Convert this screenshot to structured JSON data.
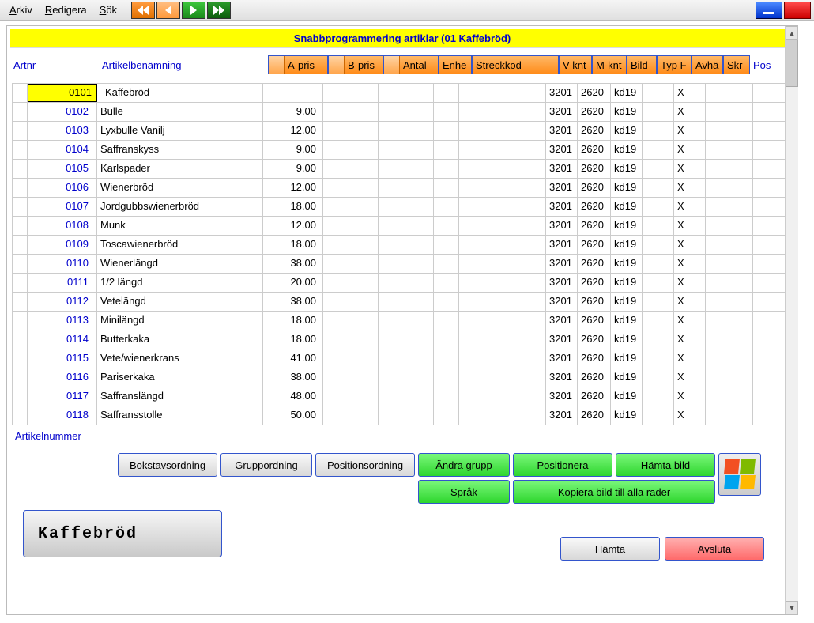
{
  "menu": {
    "arkiv": "Arkiv",
    "redigera": "Redigera",
    "sok": "Sök"
  },
  "title": "Snabbprogrammering artiklar (01 Kaffebröd)",
  "headers": {
    "artnr": "Artnr",
    "artben": "Artikelbenämning",
    "apris": "A-pris",
    "bpris": "B-pris",
    "antal": "Antal",
    "enh": "Enhe",
    "streck": "Streckkod",
    "vknt": "V-knt",
    "mknt": "M-knt",
    "bild": "Bild",
    "typf": "Typ F",
    "avha": "Avhä",
    "skr": "Skr",
    "pos": "Pos"
  },
  "rows": [
    {
      "artnr": "0101",
      "name": "Kaffebröd",
      "apris": "",
      "vknt": "3201",
      "mknt": "2620",
      "bild": "kd19",
      "avha": "X"
    },
    {
      "artnr": "0102",
      "name": "Bulle",
      "apris": "9.00",
      "vknt": "3201",
      "mknt": "2620",
      "bild": "kd19",
      "avha": "X"
    },
    {
      "artnr": "0103",
      "name": "Lyxbulle Vanilj",
      "apris": "12.00",
      "vknt": "3201",
      "mknt": "2620",
      "bild": "kd19",
      "avha": "X"
    },
    {
      "artnr": "0104",
      "name": "Saffranskyss",
      "apris": "9.00",
      "vknt": "3201",
      "mknt": "2620",
      "bild": "kd19",
      "avha": "X"
    },
    {
      "artnr": "0105",
      "name": "Karlspader",
      "apris": "9.00",
      "vknt": "3201",
      "mknt": "2620",
      "bild": "kd19",
      "avha": "X"
    },
    {
      "artnr": "0106",
      "name": "Wienerbröd",
      "apris": "12.00",
      "vknt": "3201",
      "mknt": "2620",
      "bild": "kd19",
      "avha": "X"
    },
    {
      "artnr": "0107",
      "name": "Jordgubbswienerbröd",
      "apris": "18.00",
      "vknt": "3201",
      "mknt": "2620",
      "bild": "kd19",
      "avha": "X"
    },
    {
      "artnr": "0108",
      "name": "Munk",
      "apris": "12.00",
      "vknt": "3201",
      "mknt": "2620",
      "bild": "kd19",
      "avha": "X"
    },
    {
      "artnr": "0109",
      "name": "Toscawienerbröd",
      "apris": "18.00",
      "vknt": "3201",
      "mknt": "2620",
      "bild": "kd19",
      "avha": "X"
    },
    {
      "artnr": "0110",
      "name": "Wienerlängd",
      "apris": "38.00",
      "vknt": "3201",
      "mknt": "2620",
      "bild": "kd19",
      "avha": "X"
    },
    {
      "artnr": "0111",
      "name": "1/2 längd",
      "apris": "20.00",
      "vknt": "3201",
      "mknt": "2620",
      "bild": "kd19",
      "avha": "X"
    },
    {
      "artnr": "0112",
      "name": "Vetelängd",
      "apris": "38.00",
      "vknt": "3201",
      "mknt": "2620",
      "bild": "kd19",
      "avha": "X"
    },
    {
      "artnr": "0113",
      "name": "Minilängd",
      "apris": "18.00",
      "vknt": "3201",
      "mknt": "2620",
      "bild": "kd19",
      "avha": "X"
    },
    {
      "artnr": "0114",
      "name": "Butterkaka",
      "apris": "18.00",
      "vknt": "3201",
      "mknt": "2620",
      "bild": "kd19",
      "avha": "X"
    },
    {
      "artnr": "0115",
      "name": "Vete/wienerkrans",
      "apris": "41.00",
      "vknt": "3201",
      "mknt": "2620",
      "bild": "kd19",
      "avha": "X"
    },
    {
      "artnr": "0116",
      "name": "Pariserkaka",
      "apris": "38.00",
      "vknt": "3201",
      "mknt": "2620",
      "bild": "kd19",
      "avha": "X"
    },
    {
      "artnr": "0117",
      "name": "Saffranslängd",
      "apris": "48.00",
      "vknt": "3201",
      "mknt": "2620",
      "bild": "kd19",
      "avha": "X"
    },
    {
      "artnr": "0118",
      "name": "Saffransstolle",
      "apris": "50.00",
      "vknt": "3201",
      "mknt": "2620",
      "bild": "kd19",
      "avha": "X"
    }
  ],
  "footer_label": "Artikelnummer",
  "buttons": {
    "bokstav": "Bokstavsordning",
    "grupp": "Gruppordning",
    "position": "Positionsordning",
    "andra_grupp": "Ändra grupp",
    "positionera": "Positionera",
    "hamta_bild": "Hämta bild",
    "sprak": "Språk",
    "kopiera": "Kopiera bild till alla rader",
    "hamta": "Hämta",
    "avsluta": "Avsluta"
  },
  "preview": "Kaffebröd"
}
